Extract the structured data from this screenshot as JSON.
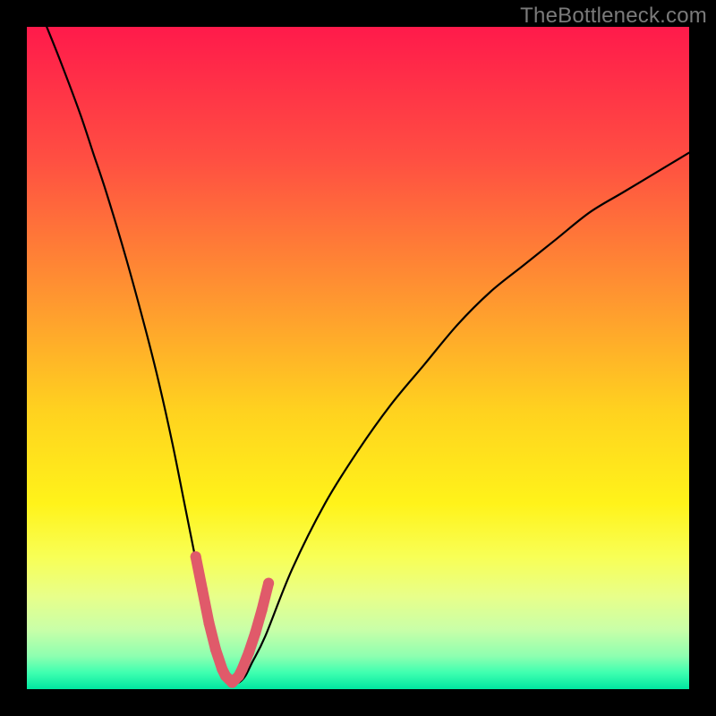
{
  "watermark": "TheBottleneck.com",
  "chart_data": {
    "type": "line",
    "title": "",
    "xlabel": "",
    "ylabel": "",
    "xlim": [
      0,
      100
    ],
    "ylim": [
      0,
      100
    ],
    "grid": false,
    "legend": false,
    "colors": {
      "gradient_stops": [
        {
          "offset": 0.0,
          "color": "#ff1a4b"
        },
        {
          "offset": 0.2,
          "color": "#ff4f42"
        },
        {
          "offset": 0.42,
          "color": "#ff9a2f"
        },
        {
          "offset": 0.58,
          "color": "#ffd21f"
        },
        {
          "offset": 0.72,
          "color": "#fff31a"
        },
        {
          "offset": 0.8,
          "color": "#f8ff55"
        },
        {
          "offset": 0.86,
          "color": "#e8ff8a"
        },
        {
          "offset": 0.91,
          "color": "#c9ffa8"
        },
        {
          "offset": 0.95,
          "color": "#8effb0"
        },
        {
          "offset": 0.975,
          "color": "#3fffb0"
        },
        {
          "offset": 1.0,
          "color": "#00e6a0"
        }
      ],
      "curve_stroke": "#000000",
      "marker": "#e05a6a"
    },
    "series": [
      {
        "name": "bottleneck-curve",
        "x": [
          3,
          5,
          8,
          10,
          12,
          15,
          18,
          20,
          22,
          24,
          26,
          27,
          28,
          29,
          30,
          31,
          32,
          33,
          34,
          36,
          40,
          45,
          50,
          55,
          60,
          65,
          70,
          75,
          80,
          85,
          90,
          95,
          100
        ],
        "y": [
          100,
          95,
          87,
          81,
          75,
          65,
          54,
          46,
          37,
          27,
          17,
          12,
          8,
          4,
          2,
          1,
          1,
          2,
          4,
          8,
          18,
          28,
          36,
          43,
          49,
          55,
          60,
          64,
          68,
          72,
          75,
          78,
          81
        ]
      }
    ],
    "markers": {
      "name": "valley-points",
      "x": [
        25.5,
        26.5,
        27.5,
        28.5,
        29.5,
        30.0,
        30.5,
        31.0,
        31.5,
        32.0,
        32.5,
        33.5,
        34.5,
        35.5,
        36.5
      ],
      "y": [
        20.0,
        15.0,
        10.0,
        6.0,
        3.0,
        2.0,
        1.5,
        1.0,
        1.5,
        2.0,
        3.0,
        5.5,
        8.5,
        12.0,
        16.0
      ]
    }
  }
}
